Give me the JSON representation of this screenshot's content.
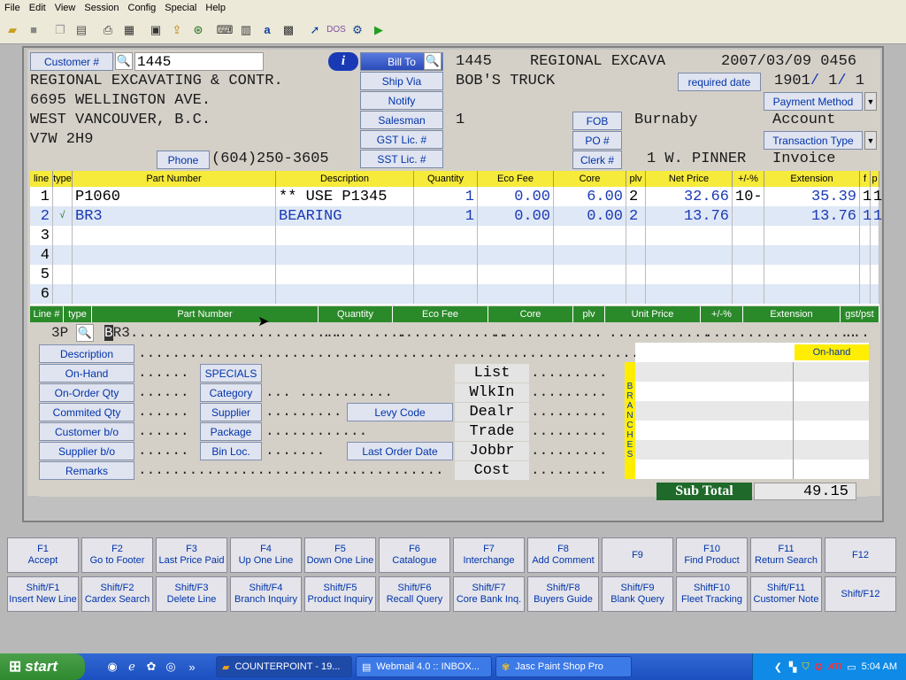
{
  "menu": [
    "File",
    "Edit",
    "View",
    "Session",
    "Config",
    "Special",
    "Help"
  ],
  "header": {
    "customer_label": "Customer #",
    "customer_value": "1445",
    "customer_name": "REGIONAL EXCAVATING & CONTR.",
    "address1": "6695 WELLINGTON AVE.",
    "address2": "WEST VANCOUVER, B.C.",
    "postal": "V7W 2H9",
    "phone_label": "Phone",
    "phone_area": "604",
    "phone_prefix": "250",
    "phone_line": "3605",
    "bill_to_label": "Bill To",
    "bill_to_value": "1445",
    "bill_to_name": "REGIONAL EXCAVA",
    "date_time": "2007/03/09 0456",
    "ship_via_label": "Ship Via",
    "ship_via_value": "BOB'S TRUCK",
    "notify_label": "Notify",
    "required_date_label": "required date",
    "req_date_a": "1901",
    "req_date_b": "1",
    "req_date_c": "1",
    "salesman_label": "Salesman",
    "salesman_value": "1",
    "fob_label": "FOB",
    "fob_value": "Burnaby",
    "payment_method_label": "Payment Method",
    "payment_method_value": "Account",
    "gst_label": "GST Lic. #",
    "po_label": "PO #",
    "transaction_type_label": "Transaction Type",
    "transaction_type_value": "Invoice",
    "sst_label": "SST Lic. #",
    "clerk_label": "Clerk #",
    "clerk_value": "1 W. PINNER"
  },
  "grid": {
    "headers": [
      "line",
      "type",
      "Part Number",
      "Description",
      "Quantity",
      "Eco Fee",
      "Core",
      "plv",
      "Net Price",
      "+/-%",
      "Extension",
      "f",
      "p"
    ],
    "rows": [
      {
        "line": "1",
        "type": "",
        "part": "P1060",
        "desc": "** USE P1345",
        "qty": "1",
        "eco": "0.00",
        "core": "6.00",
        "plv": "2",
        "net": "32.66",
        "pm": "10-",
        "ext": "35.39",
        "f": "1",
        "p": "1"
      },
      {
        "line": "2",
        "type": "√",
        "part": "BR3",
        "desc": "BEARING",
        "qty": "1",
        "eco": "0.00",
        "core": "0.00",
        "plv": "2",
        "net": "13.76",
        "pm": "",
        "ext": "13.76",
        "f": "1",
        "p": "1"
      },
      {
        "line": "3",
        "type": "",
        "part": "",
        "desc": "",
        "qty": "",
        "eco": "",
        "core": "",
        "plv": "",
        "net": "",
        "pm": "",
        "ext": "",
        "f": "",
        "p": ""
      },
      {
        "line": "4",
        "type": "",
        "part": "",
        "desc": "",
        "qty": "",
        "eco": "",
        "core": "",
        "plv": "",
        "net": "",
        "pm": "",
        "ext": "",
        "f": "",
        "p": ""
      },
      {
        "line": "5",
        "type": "",
        "part": "",
        "desc": "",
        "qty": "",
        "eco": "",
        "core": "",
        "plv": "",
        "net": "",
        "pm": "",
        "ext": "",
        "f": "",
        "p": ""
      },
      {
        "line": "6",
        "type": "",
        "part": "",
        "desc": "",
        "qty": "",
        "eco": "",
        "core": "",
        "plv": "",
        "net": "",
        "pm": "",
        "ext": "",
        "f": "",
        "p": ""
      }
    ]
  },
  "entry": {
    "headers": [
      "Line #",
      "type",
      "Part Number",
      "Quantity",
      "Eco Fee",
      "Core",
      "plv",
      "Unit Price",
      "+/-%",
      "Extension",
      "gst/pst"
    ],
    "line": "3P",
    "part_cursor": "B",
    "part_rest": "R3"
  },
  "detail": {
    "labels": [
      "Description",
      "On-Hand",
      "On-Order Qty",
      "Commited Qty",
      "Customer b/o",
      "Supplier b/o",
      "Remarks"
    ],
    "mid_labels": [
      "SPECIALS",
      "Category",
      "Supplier",
      "Package",
      "Bin Loc."
    ],
    "levy_code": "Levy Code",
    "last_order_date": "Last Order Date",
    "prices": [
      "List",
      "WlkIn",
      "Dealr",
      "Trade",
      "Jobbr",
      "Cost"
    ],
    "branches": [
      "B",
      "R",
      "A",
      "N",
      "C",
      "H",
      "E",
      "S"
    ],
    "on_hand_header": "On-hand",
    "sub_total_label": "Sub Total",
    "sub_total_value": "49.15"
  },
  "fkeys": [
    {
      "key": "F1",
      "label": "Accept"
    },
    {
      "key": "F2",
      "label": "Go to Footer"
    },
    {
      "key": "F3",
      "label": "Last Price Paid"
    },
    {
      "key": "F4",
      "label": "Up One Line"
    },
    {
      "key": "F5",
      "label": "Down One Line"
    },
    {
      "key": "F6",
      "label": "Catalogue"
    },
    {
      "key": "F7",
      "label": "Interchange"
    },
    {
      "key": "F8",
      "label": "Add Comment"
    },
    {
      "key": "F9",
      "label": ""
    },
    {
      "key": "F10",
      "label": "Find Product"
    },
    {
      "key": "F11",
      "label": "Return Search"
    },
    {
      "key": "F12",
      "label": ""
    }
  ],
  "shift_fkeys": [
    {
      "key": "Shift/F1",
      "label": "Insert New Line"
    },
    {
      "key": "Shift/F2",
      "label": "Cardex Search"
    },
    {
      "key": "Shift/F3",
      "label": "Delete Line"
    },
    {
      "key": "Shift/F4",
      "label": "Branch Inquiry"
    },
    {
      "key": "Shift/F5",
      "label": "Product Inquiry"
    },
    {
      "key": "Shift/F6",
      "label": "Recall Query"
    },
    {
      "key": "Shift/F7",
      "label": "Core Bank Inq."
    },
    {
      "key": "Shift/F8",
      "label": "Buyers Guide"
    },
    {
      "key": "Shift/F9",
      "label": "Blank Query"
    },
    {
      "key": "ShiftF10",
      "label": "Fleet Tracking"
    },
    {
      "key": "Shift/F11",
      "label": "Customer Note"
    },
    {
      "key": "Shift/F12",
      "label": ""
    }
  ],
  "taskbar": {
    "start": "start",
    "tasks": [
      "COUNTERPOINT - 19...",
      "Webmail 4.0 :: INBOX...",
      "Jasc Paint Shop Pro"
    ],
    "clock": "5:04 AM"
  }
}
